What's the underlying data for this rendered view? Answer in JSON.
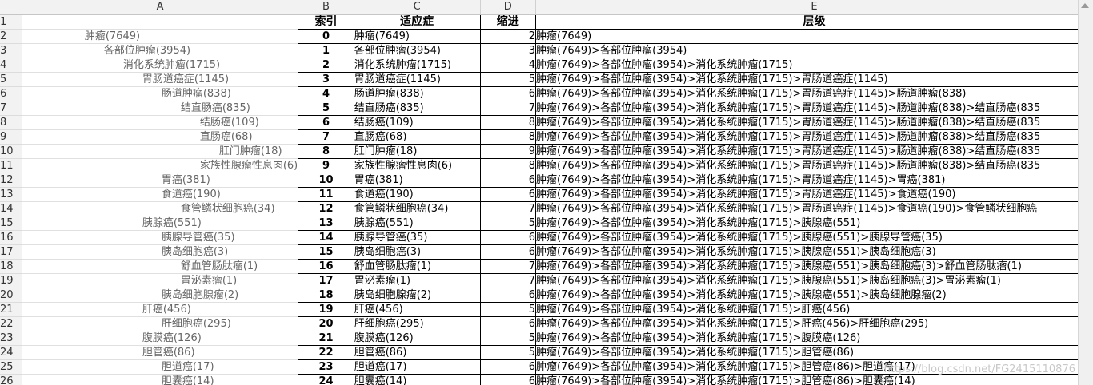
{
  "columns": [
    "A",
    "B",
    "C",
    "D",
    "E"
  ],
  "header_row": {
    "num": "1",
    "a": "",
    "b": "索引",
    "c": "适应症",
    "d": "缩进",
    "e": "层级"
  },
  "rows": [
    {
      "num": "2",
      "a": "肿瘤(7649)",
      "ind": 2,
      "b": "0",
      "c": "肿瘤(7649)",
      "d": "2",
      "e": "肿瘤(7649)"
    },
    {
      "num": "3",
      "a": "各部位肿瘤(3954)",
      "ind": 3,
      "b": "1",
      "c": "各部位肿瘤(3954)",
      "d": "3",
      "e": "肿瘤(7649)>各部位肿瘤(3954)"
    },
    {
      "num": "4",
      "a": "消化系统肿瘤(1715)",
      "ind": 4,
      "b": "2",
      "c": "消化系统肿瘤(1715)",
      "d": "4",
      "e": "肿瘤(7649)>各部位肿瘤(3954)>消化系统肿瘤(1715)"
    },
    {
      "num": "5",
      "a": "胃肠道癌症(1145)",
      "ind": 5,
      "b": "3",
      "c": "胃肠道癌症(1145)",
      "d": "5",
      "e": "肿瘤(7649)>各部位肿瘤(3954)>消化系统肿瘤(1715)>胃肠道癌症(1145)"
    },
    {
      "num": "6",
      "a": "肠道肿瘤(838)",
      "ind": 6,
      "b": "4",
      "c": "肠道肿瘤(838)",
      "d": "6",
      "e": "肿瘤(7649)>各部位肿瘤(3954)>消化系统肿瘤(1715)>胃肠道癌症(1145)>肠道肿瘤(838)"
    },
    {
      "num": "7",
      "a": "结直肠癌(835)",
      "ind": 7,
      "b": "5",
      "c": "结直肠癌(835)",
      "d": "7",
      "e": "肿瘤(7649)>各部位肿瘤(3954)>消化系统肿瘤(1715)>胃肠道癌症(1145)>肠道肿瘤(838)>结直肠癌(835"
    },
    {
      "num": "8",
      "a": "结肠癌(109)",
      "ind": 8,
      "b": "6",
      "c": "结肠癌(109)",
      "d": "8",
      "e": "肿瘤(7649)>各部位肿瘤(3954)>消化系统肿瘤(1715)>胃肠道癌症(1145)>肠道肿瘤(838)>结直肠癌(835"
    },
    {
      "num": "9",
      "a": "直肠癌(68)",
      "ind": 8,
      "b": "7",
      "c": "直肠癌(68)",
      "d": "8",
      "e": "肿瘤(7649)>各部位肿瘤(3954)>消化系统肿瘤(1715)>胃肠道癌症(1145)>肠道肿瘤(838)>结直肠癌(835"
    },
    {
      "num": "10",
      "a": "肛门肿瘤(18)",
      "ind": 9,
      "b": "8",
      "c": "肛门肿瘤(18)",
      "d": "9",
      "e": "肿瘤(7649)>各部位肿瘤(3954)>消化系统肿瘤(1715)>胃肠道癌症(1145)>肠道肿瘤(838)>结直肠癌(835"
    },
    {
      "num": "11",
      "a": "家族性腺瘤性息肉(6)",
      "ind": 8,
      "b": "9",
      "c": "家族性腺瘤性息肉(6)",
      "d": "8",
      "e": "肿瘤(7649)>各部位肿瘤(3954)>消化系统肿瘤(1715)>胃肠道癌症(1145)>肠道肿瘤(838)>结直肠癌(835"
    },
    {
      "num": "12",
      "a": "胃癌(381)",
      "ind": 6,
      "b": "10",
      "c": "胃癌(381)",
      "d": "6",
      "e": "肿瘤(7649)>各部位肿瘤(3954)>消化系统肿瘤(1715)>胃肠道癌症(1145)>胃癌(381)"
    },
    {
      "num": "13",
      "a": "食道癌(190)",
      "ind": 6,
      "b": "11",
      "c": "食道癌(190)",
      "d": "6",
      "e": "肿瘤(7649)>各部位肿瘤(3954)>消化系统肿瘤(1715)>胃肠道癌症(1145)>食道癌(190)"
    },
    {
      "num": "14",
      "a": "食管鳞状细胞癌(34)",
      "ind": 7,
      "b": "12",
      "c": "食管鳞状细胞癌(34)",
      "d": "7",
      "e": "肿瘤(7649)>各部位肿瘤(3954)>消化系统肿瘤(1715)>胃肠道癌症(1145)>食道癌(190)>食管鳞状细胞癌"
    },
    {
      "num": "15",
      "a": "胰腺癌(551)",
      "ind": 5,
      "b": "13",
      "c": "胰腺癌(551)",
      "d": "5",
      "e": "肿瘤(7649)>各部位肿瘤(3954)>消化系统肿瘤(1715)>胰腺癌(551)"
    },
    {
      "num": "16",
      "a": "胰腺导管癌(35)",
      "ind": 6,
      "b": "14",
      "c": "胰腺导管癌(35)",
      "d": "6",
      "e": "肿瘤(7649)>各部位肿瘤(3954)>消化系统肿瘤(1715)>胰腺癌(551)>胰腺导管癌(35)"
    },
    {
      "num": "17",
      "a": "胰岛细胞癌(3)",
      "ind": 6,
      "b": "15",
      "c": "胰岛细胞癌(3)",
      "d": "6",
      "e": "肿瘤(7649)>各部位肿瘤(3954)>消化系统肿瘤(1715)>胰腺癌(551)>胰岛细胞癌(3)"
    },
    {
      "num": "18",
      "a": "舒血管肠肽瘤(1)",
      "ind": 7,
      "b": "16",
      "c": "舒血管肠肽瘤(1)",
      "d": "7",
      "e": "肿瘤(7649)>各部位肿瘤(3954)>消化系统肿瘤(1715)>胰腺癌(551)>胰岛细胞癌(3)>舒血管肠肽瘤(1)"
    },
    {
      "num": "19",
      "a": "胃泌素瘤(1)",
      "ind": 7,
      "b": "17",
      "c": "胃泌素瘤(1)",
      "d": "7",
      "e": "肿瘤(7649)>各部位肿瘤(3954)>消化系统肿瘤(1715)>胰腺癌(551)>胰岛细胞癌(3)>胃泌素瘤(1)"
    },
    {
      "num": "20",
      "a": "胰岛细胞腺瘤(2)",
      "ind": 6,
      "b": "18",
      "c": "胰岛细胞腺瘤(2)",
      "d": "6",
      "e": "肿瘤(7649)>各部位肿瘤(3954)>消化系统肿瘤(1715)>胰腺癌(551)>胰岛细胞腺瘤(2)"
    },
    {
      "num": "21",
      "a": "肝癌(456)",
      "ind": 5,
      "b": "19",
      "c": "肝癌(456)",
      "d": "5",
      "e": "肿瘤(7649)>各部位肿瘤(3954)>消化系统肿瘤(1715)>肝癌(456)"
    },
    {
      "num": "22",
      "a": "肝细胞癌(295)",
      "ind": 6,
      "b": "20",
      "c": "肝细胞癌(295)",
      "d": "6",
      "e": "肿瘤(7649)>各部位肿瘤(3954)>消化系统肿瘤(1715)>肝癌(456)>肝细胞癌(295)"
    },
    {
      "num": "23",
      "a": "腹膜癌(126)",
      "ind": 5,
      "b": "21",
      "c": "腹膜癌(126)",
      "d": "5",
      "e": "肿瘤(7649)>各部位肿瘤(3954)>消化系统肿瘤(1715)>腹膜癌(126)"
    },
    {
      "num": "24",
      "a": "胆管癌(86)",
      "ind": 5,
      "b": "22",
      "c": "胆管癌(86)",
      "d": "5",
      "e": "肿瘤(7649)>各部位肿瘤(3954)>消化系统肿瘤(1715)>胆管癌(86)"
    },
    {
      "num": "25",
      "a": "胆道癌(17)",
      "ind": 6,
      "b": "23",
      "c": "胆道癌(17)",
      "d": "6",
      "e": "肿瘤(7649)>各部位肿瘤(3954)>消化系统肿瘤(1715)>胆管癌(86)>胆道癌(17)"
    },
    {
      "num": "26",
      "a": "胆囊癌(14)",
      "ind": 6,
      "b": "24",
      "c": "胆囊癌(14)",
      "d": "6",
      "e": "肿瘤(7649)>各部位肿瘤(3954)>消化系统肿瘤(1715)>胆管癌(86)>胆囊癌(14)"
    }
  ],
  "watermark": "https://blog.csdn.net/FG2415110876"
}
